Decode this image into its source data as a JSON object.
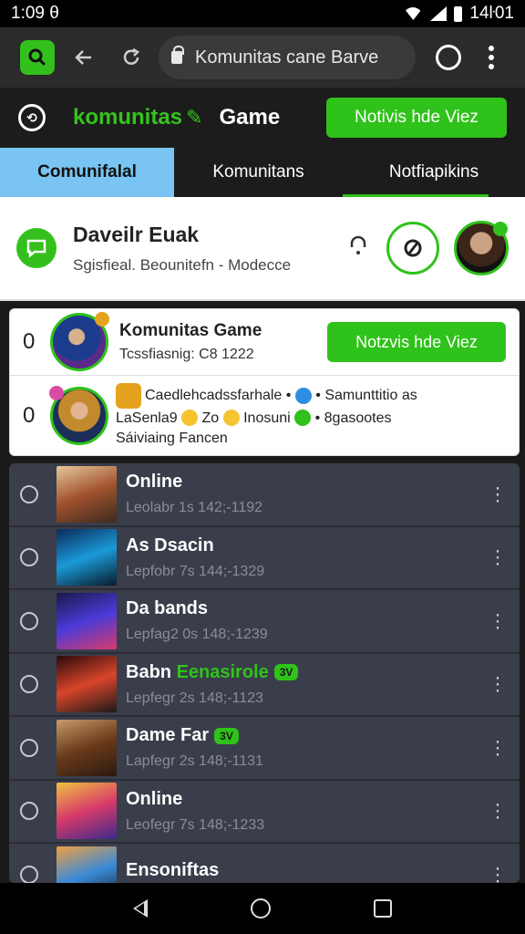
{
  "status_bar": {
    "time": "1:09",
    "time_suffix": "θ",
    "battery_text": "14ŀ01"
  },
  "browser": {
    "url": "Komunitas cane Barve",
    "notification_badge": ""
  },
  "header": {
    "brand": "komunitas",
    "title": "Game",
    "cta_label": "Notivis hde Viez"
  },
  "tabs": [
    {
      "label": "Comunifalal"
    },
    {
      "label": "Komunitans"
    },
    {
      "label": "Notfiapikins"
    }
  ],
  "profile": {
    "name": "Daveilr Euak",
    "subtitle": "Sgisfieal. Beounitefn - Modecce"
  },
  "card": {
    "row1": {
      "count": "0",
      "title": "Komunitas Game",
      "subtitle": "Tcssfiasnig: C8 1222",
      "cta": "Notzvis hde Viez"
    },
    "row2": {
      "count": "0",
      "line1a": "Caedlehcadssfarhale",
      "line1b": "Samunttitio as",
      "line2a": "LaSenla9",
      "line2b": "Zo",
      "line2c": "Inosuni",
      "line2d": "8gasootes",
      "line3": "Sáiviaing Fancen"
    }
  },
  "list": [
    {
      "title": "Online",
      "highlight": "",
      "chip": "",
      "meta": "Leolabr 1s 142;-1192"
    },
    {
      "title": "As Dsacin",
      "highlight": "",
      "chip": "",
      "meta": "Lepfobr 7s 144;-1329"
    },
    {
      "title": "Da bands",
      "highlight": "",
      "chip": "",
      "meta": "Lepfag2 0s 148;-1239"
    },
    {
      "title": "Babn",
      "highlight": "Eenasirole",
      "chip": "3V",
      "meta": "Lepfegr 2s 148;-1123"
    },
    {
      "title": "Dame Far",
      "highlight": "",
      "chip": "3V",
      "meta": "Lapfegr 2s 148;-1131"
    },
    {
      "title": "Online",
      "highlight": "",
      "chip": "",
      "meta": "Leofegr 7s 148;-1233"
    },
    {
      "title": "Ensoniftas",
      "highlight": "",
      "chip": "",
      "meta": ""
    }
  ]
}
